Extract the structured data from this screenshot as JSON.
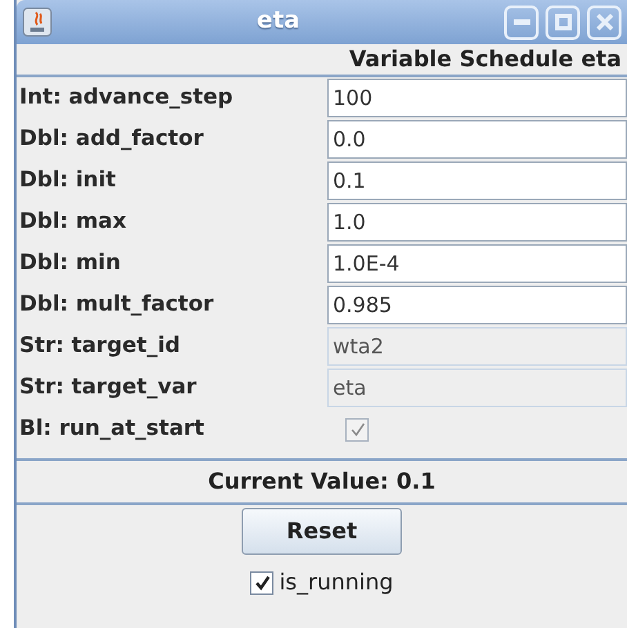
{
  "window": {
    "title": "eta"
  },
  "header": "Variable Schedule eta",
  "params": [
    {
      "label": "Int: advance_step",
      "kind": "field",
      "value": "100",
      "editable": true
    },
    {
      "label": "Dbl: add_factor",
      "kind": "field",
      "value": "0.0",
      "editable": true
    },
    {
      "label": "Dbl: init",
      "kind": "field",
      "value": "0.1",
      "editable": true
    },
    {
      "label": "Dbl: max",
      "kind": "field",
      "value": "1.0",
      "editable": true
    },
    {
      "label": "Dbl: min",
      "kind": "field",
      "value": "1.0E-4",
      "editable": true
    },
    {
      "label": "Dbl: mult_factor",
      "kind": "field",
      "value": "0.985",
      "editable": true
    },
    {
      "label": "Str: target_id",
      "kind": "field",
      "value": "wta2",
      "editable": false
    },
    {
      "label": "Str: target_var",
      "kind": "field",
      "value": "eta",
      "editable": false
    },
    {
      "label": "Bl: run_at_start",
      "kind": "checkbox",
      "checked": true,
      "disabled": true
    }
  ],
  "current_value": "Current Value: 0.1",
  "reset_button": "Reset",
  "running": {
    "label": "is_running",
    "checked": true
  }
}
